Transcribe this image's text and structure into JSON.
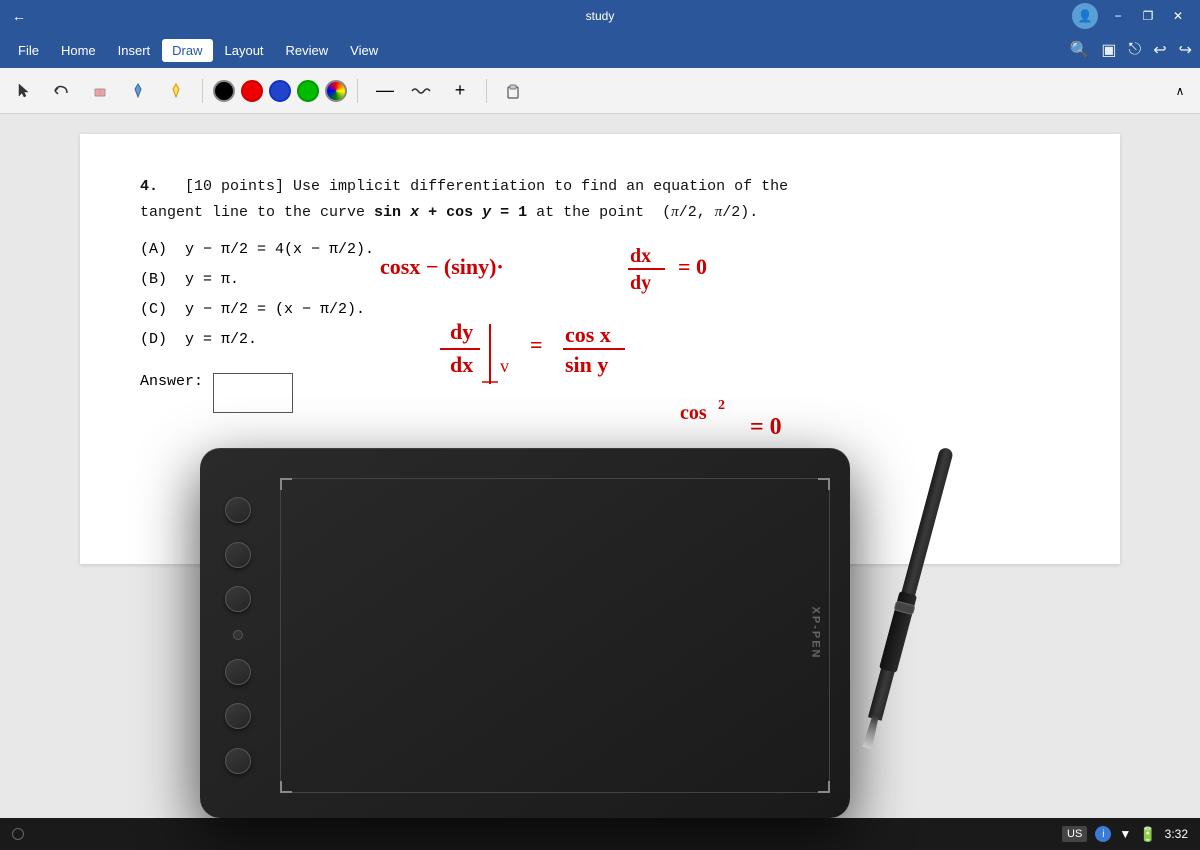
{
  "app": {
    "title": "study",
    "back_btn": "←"
  },
  "titlebar": {
    "minimize": "−",
    "restore": "❐",
    "close": "✕",
    "user_icon": "👤"
  },
  "menubar": {
    "items": [
      "File",
      "Home",
      "Insert",
      "Draw",
      "Layout",
      "Review",
      "View"
    ],
    "active": "Draw"
  },
  "toolbar": {
    "tools": [
      "cursor",
      "undo_gesture",
      "lasso",
      "filter",
      "filter2"
    ],
    "colors": [
      "black",
      "red",
      "blue",
      "green",
      "multicolor"
    ],
    "line_tools": [
      "dash",
      "wave",
      "plus"
    ],
    "paste": "paste",
    "collapse": "^"
  },
  "content": {
    "question_number": "4.",
    "question_text": "[10 points] Use implicit differentiation to find an equation of the tangent line to the curve sin x + cos y = 1 at the point (π/2, π/2).",
    "choices": [
      "(A)  y − π/2 = 4(x − π/2).",
      "(B)  y = π.",
      "(C)  y − π/2 = (x − π/2).",
      "(D)  y = π/2."
    ],
    "answer_label": "Answer:"
  },
  "handwriting": {
    "lines": [
      "cosx − (siny)·dx/dy = 0",
      "dy/dx = cosx/siny",
      "cos²..."
    ]
  },
  "statusbar": {
    "locale": "US",
    "time": "3:32",
    "info_icon": "i",
    "battery": "▮"
  },
  "tablet": {
    "brand": "XP-PEN",
    "buttons": 6
  }
}
